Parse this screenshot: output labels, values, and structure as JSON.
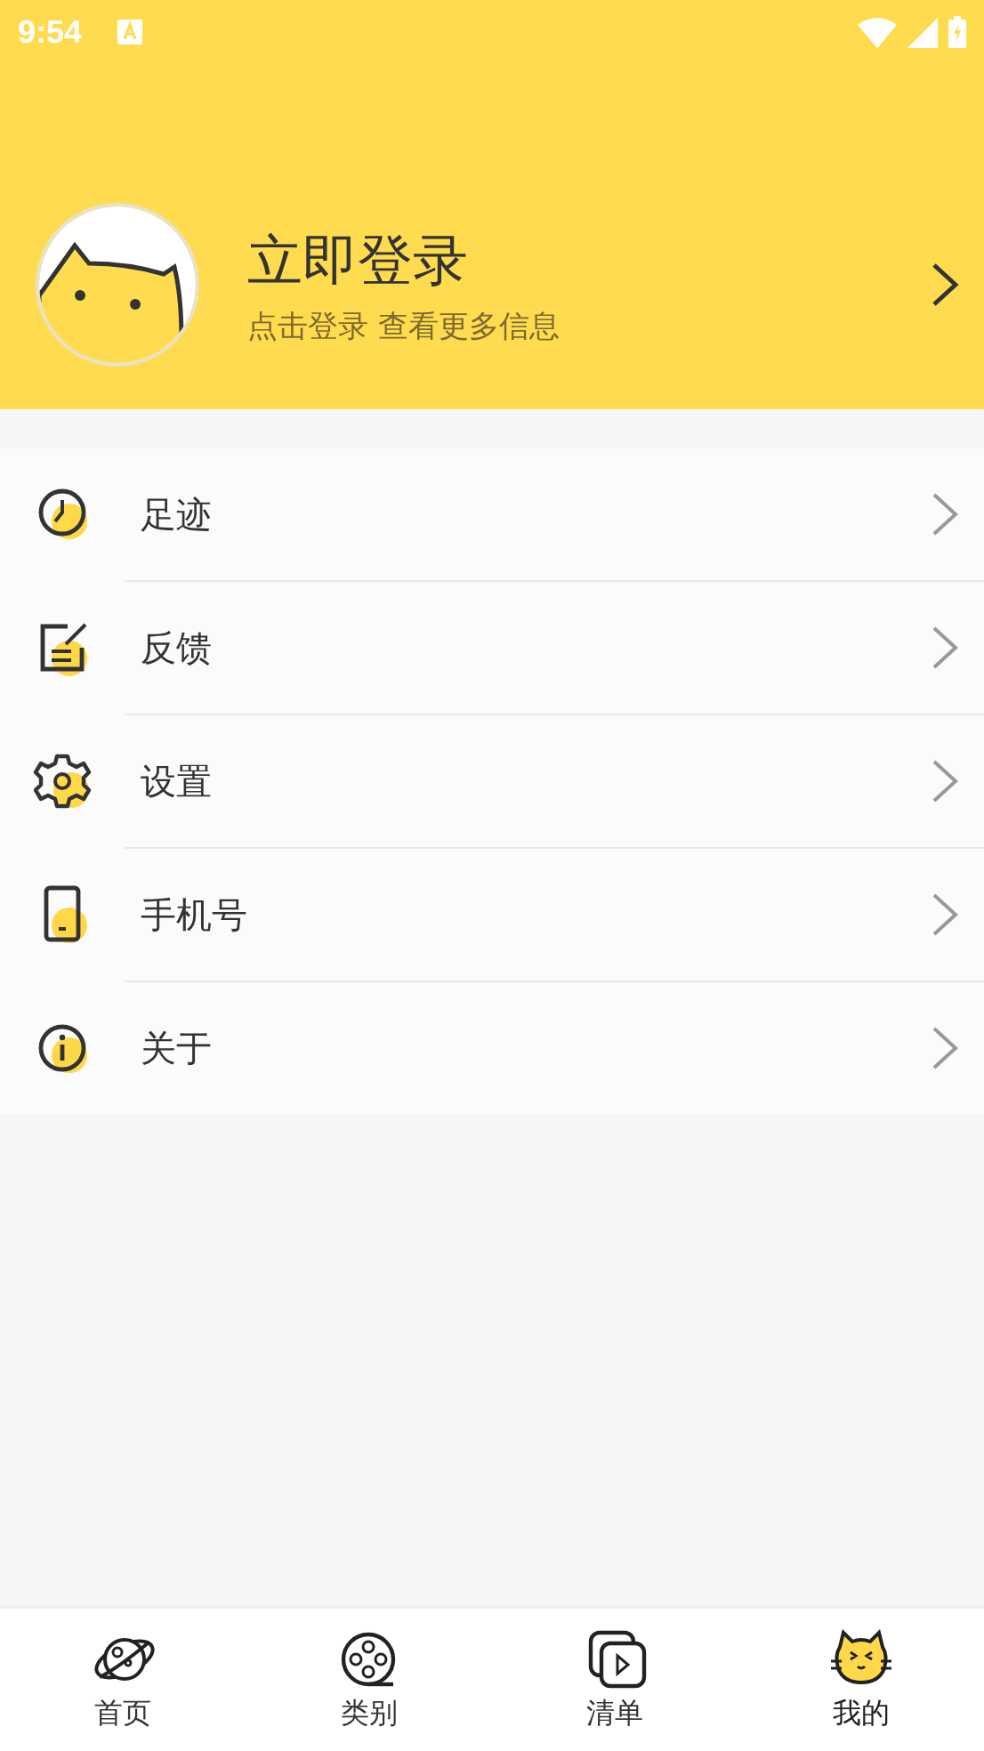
{
  "status_bar": {
    "time": "9:54"
  },
  "profile": {
    "title": "立即登录",
    "subtitle": "点击登录 查看更多信息"
  },
  "menu": [
    {
      "kind": "clock",
      "label": "足迹"
    },
    {
      "kind": "note",
      "label": "反馈"
    },
    {
      "kind": "gear",
      "label": "设置"
    },
    {
      "kind": "phone",
      "label": "手机号"
    },
    {
      "kind": "info",
      "label": "关于"
    }
  ],
  "tabs": [
    {
      "kind": "planet",
      "label": "首页",
      "selected": false
    },
    {
      "kind": "film",
      "label": "类别",
      "selected": false
    },
    {
      "kind": "playlist",
      "label": "清单",
      "selected": false
    },
    {
      "kind": "cat",
      "label": "我的",
      "selected": true
    }
  ]
}
